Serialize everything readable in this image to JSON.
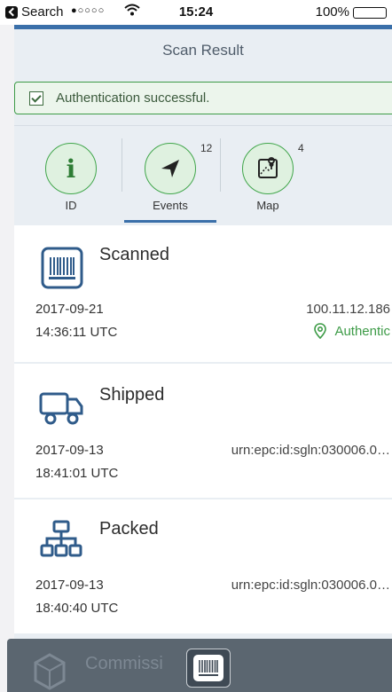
{
  "status_bar": {
    "carrier": "Search",
    "signal": "●○○○○",
    "time": "15:24",
    "battery": "100%"
  },
  "header": {
    "title": "Scan Result"
  },
  "alert": {
    "message": "Authentication successful."
  },
  "tabs": [
    {
      "label": "ID",
      "icon": "info-icon",
      "badge": ""
    },
    {
      "label": "Events",
      "icon": "navigation-arrow-icon",
      "badge": "12"
    },
    {
      "label": "Map",
      "icon": "map-icon",
      "badge": "4"
    }
  ],
  "events": [
    {
      "title": "Scanned",
      "icon": "barcode-scan-icon",
      "date": "2017-09-21",
      "time": "14:36:11 UTC",
      "location": "100.11.12.186",
      "status": "Authentic"
    },
    {
      "title": "Shipped",
      "icon": "truck-icon",
      "date": "2017-09-13",
      "time": "18:41:01 UTC",
      "location": "urn:epc:id:sgln:030006.0…"
    },
    {
      "title": "Packed",
      "icon": "hierarchy-icon",
      "date": "2017-09-13",
      "time": "18:40:40 UTC",
      "location": "urn:epc:id:sgln:030006.0…"
    },
    {
      "title": "Commissi",
      "icon": "cube-icon"
    }
  ],
  "colors": {
    "accent": "#3a6fa9",
    "success": "#3d9b47",
    "background": "#e9eef3"
  }
}
